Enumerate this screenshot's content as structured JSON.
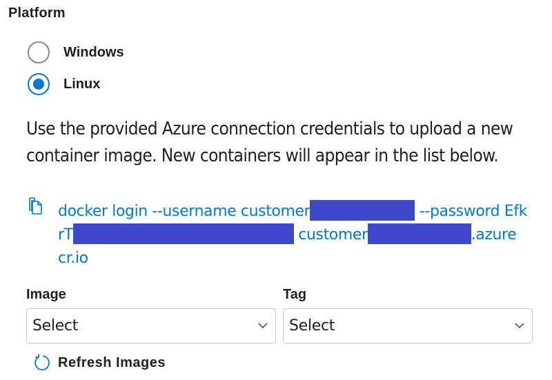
{
  "platform": {
    "label": "Platform",
    "options": [
      {
        "label": "Windows",
        "selected": false
      },
      {
        "label": "Linux",
        "selected": true
      }
    ]
  },
  "description": "Use the provided Azure connection credentials to upload a new container image. New containers will appear in the list below.",
  "command": {
    "line1_part1": "docker login --username customer",
    "line1_part2": " --password Efk",
    "line2_part1": "rT",
    "line2_part2": " customer",
    "line2_part3": ".azure",
    "line3": "cr.io",
    "redaction_color": "#3f48cc"
  },
  "image_field": {
    "label": "Image",
    "value": "Select"
  },
  "tag_field": {
    "label": "Tag",
    "value": "Select"
  },
  "refresh": {
    "label": "Refresh Images"
  },
  "colors": {
    "accent": "#0078d4",
    "text": "#201f1e",
    "border": "#c8c6c4"
  }
}
